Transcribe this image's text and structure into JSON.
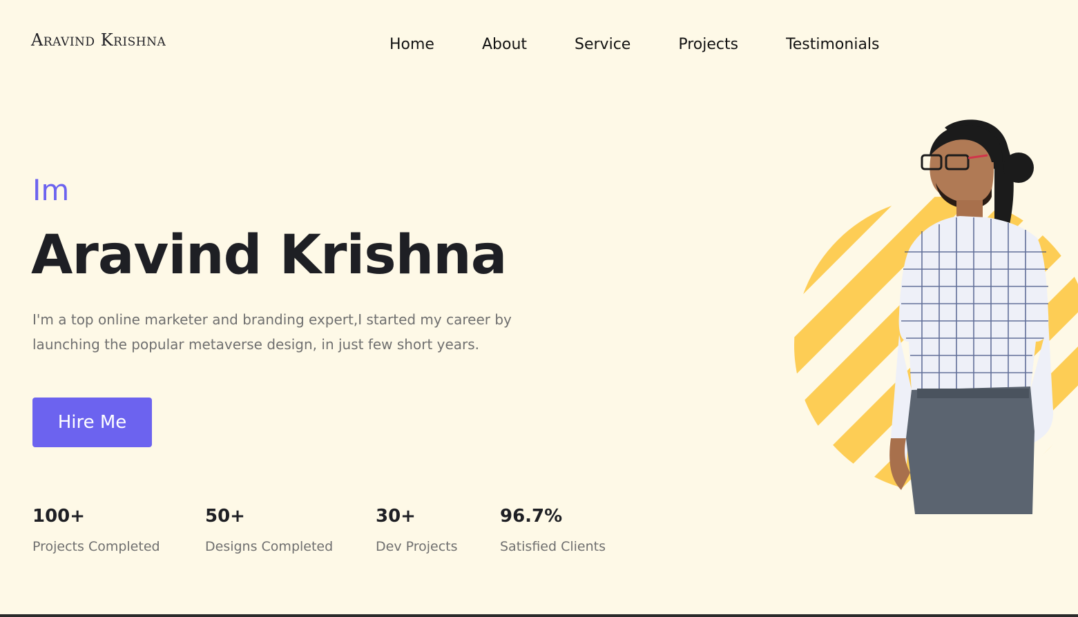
{
  "header": {
    "logo": "Aravind Krishna",
    "nav": [
      "Home",
      "About",
      "Service",
      "Projects",
      "Testimonials"
    ]
  },
  "hero": {
    "intro": "Im",
    "name": "Aravind Krishna",
    "description": "I'm a top online marketer and branding expert,I started my career by launching the popular metaverse design, in just few short years.",
    "cta_label": "Hire Me"
  },
  "stats": [
    {
      "value": "100+",
      "label": "Projects Completed"
    },
    {
      "value": "50+",
      "label": "Designs Completed"
    },
    {
      "value": "30+",
      "label": "Dev Projects"
    },
    {
      "value": "96.7%",
      "label": "Satisfied Clients"
    }
  ],
  "colors": {
    "background": "#fef9e7",
    "accent": "#6c63ef",
    "decor": "#fdcd55",
    "heading": "#1e1f24",
    "muted": "#6f6f6f"
  }
}
